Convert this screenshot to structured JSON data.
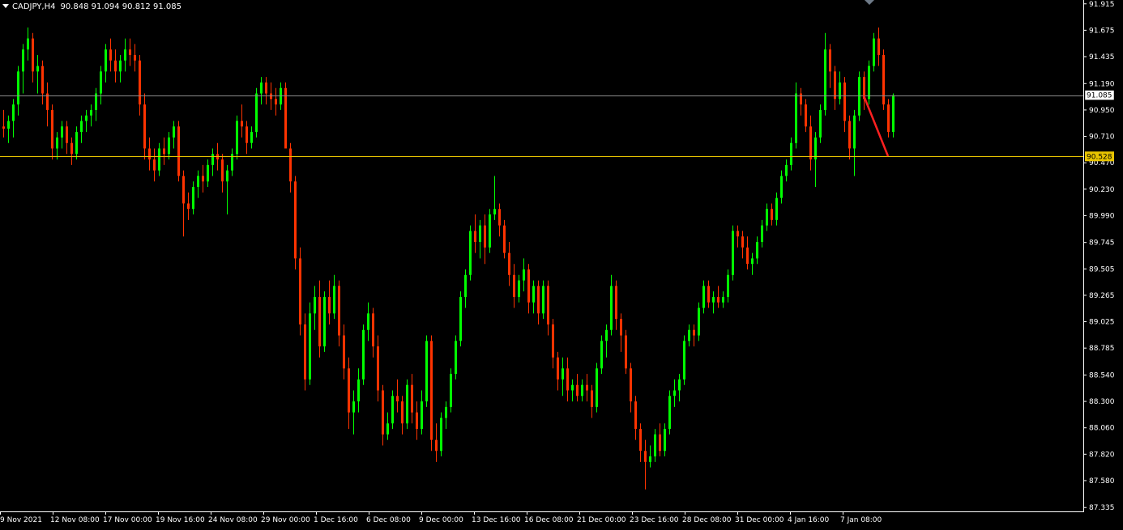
{
  "header": {
    "symbol": "CADJPY,H4",
    "ohlc": "90.848 91.094 90.812 91.085"
  },
  "colors": {
    "background": "#000000",
    "bull": "#00ff00",
    "bear": "#ff3300",
    "axis": "#ffffff",
    "bid_line": "#8c8c8c",
    "level_line": "#e8c400",
    "trend_line": "#ff2020"
  },
  "price_axis": {
    "labels": [
      "91.915",
      "91.675",
      "91.435",
      "91.190",
      "90.950",
      "90.710",
      "90.470",
      "90.230",
      "89.990",
      "89.745",
      "89.505",
      "89.265",
      "89.025",
      "88.785",
      "88.540",
      "88.300",
      "88.060",
      "87.820",
      "87.580",
      "87.335"
    ],
    "current_price": "91.085",
    "level_price": "90.528"
  },
  "time_axis": {
    "labels": [
      "9 Nov 2021",
      "12 Nov 08:00",
      "17 Nov 00:00",
      "19 Nov 16:00",
      "24 Nov 08:00",
      "29 Nov 00:00",
      "1 Dec 16:00",
      "6 Dec 08:00",
      "9 Dec 00:00",
      "13 Dec 16:00",
      "16 Dec 08:00",
      "21 Dec 00:00",
      "23 Dec 16:00",
      "28 Dec 08:00",
      "31 Dec 00:00",
      "4 Jan 16:00",
      "7 Jan 08:00"
    ]
  },
  "chart_data": {
    "type": "candlestick",
    "symbol": "CADJPY",
    "timeframe": "H4",
    "ylim": [
      87.3,
      91.95
    ],
    "y_ticks": [
      91.915,
      91.675,
      91.435,
      91.19,
      90.95,
      90.71,
      90.47,
      90.23,
      89.99,
      89.745,
      89.505,
      89.265,
      89.025,
      88.785,
      88.54,
      88.3,
      88.06,
      87.82,
      87.58,
      87.335
    ],
    "horizontal_lines": [
      {
        "price": 91.085,
        "label": "91.085",
        "role": "bid"
      },
      {
        "price": 90.528,
        "label": "90.528",
        "role": "level"
      }
    ],
    "trend_line": {
      "from_bar": 177,
      "from_price": 91.08,
      "to_bar": 182,
      "to_price": 90.53
    },
    "ohlc": [
      [
        90.8,
        90.95,
        90.7,
        90.78
      ],
      [
        90.78,
        90.9,
        90.65,
        90.85
      ],
      [
        90.85,
        91.05,
        90.7,
        91.0
      ],
      [
        91.0,
        91.35,
        90.9,
        91.3
      ],
      [
        91.3,
        91.55,
        91.1,
        91.5
      ],
      [
        91.5,
        91.7,
        91.4,
        91.6
      ],
      [
        91.6,
        91.65,
        91.2,
        91.3
      ],
      [
        91.3,
        91.45,
        91.1,
        91.35
      ],
      [
        91.35,
        91.4,
        91.0,
        91.1
      ],
      [
        91.1,
        91.2,
        90.8,
        90.95
      ],
      [
        90.95,
        91.0,
        90.5,
        90.6
      ],
      [
        90.6,
        90.75,
        90.5,
        90.7
      ],
      [
        90.7,
        90.85,
        90.6,
        90.8
      ],
      [
        90.8,
        90.85,
        90.55,
        90.65
      ],
      [
        90.65,
        90.7,
        90.45,
        90.55
      ],
      [
        90.55,
        90.8,
        90.5,
        90.75
      ],
      [
        90.75,
        90.9,
        90.65,
        90.85
      ],
      [
        90.85,
        90.95,
        90.75,
        90.9
      ],
      [
        90.9,
        91.0,
        90.8,
        90.95
      ],
      [
        90.95,
        91.15,
        90.85,
        91.1
      ],
      [
        91.1,
        91.35,
        91.0,
        91.3
      ],
      [
        91.3,
        91.55,
        91.2,
        91.5
      ],
      [
        91.5,
        91.6,
        91.3,
        91.4
      ],
      [
        91.4,
        91.5,
        91.2,
        91.3
      ],
      [
        91.3,
        91.45,
        91.2,
        91.4
      ],
      [
        91.4,
        91.6,
        91.3,
        91.5
      ],
      [
        91.5,
        91.6,
        91.35,
        91.45
      ],
      [
        91.45,
        91.55,
        91.3,
        91.4
      ],
      [
        91.4,
        91.45,
        90.9,
        91.0
      ],
      [
        91.0,
        91.1,
        90.5,
        90.6
      ],
      [
        90.6,
        90.7,
        90.4,
        90.5
      ],
      [
        90.5,
        90.6,
        90.3,
        90.4
      ],
      [
        90.4,
        90.65,
        90.35,
        90.6
      ],
      [
        90.6,
        90.7,
        90.45,
        90.55
      ],
      [
        90.55,
        90.75,
        90.5,
        90.7
      ],
      [
        90.7,
        90.85,
        90.6,
        90.8
      ],
      [
        90.8,
        90.85,
        90.3,
        90.35
      ],
      [
        90.35,
        90.4,
        89.8,
        90.1
      ],
      [
        90.1,
        90.2,
        89.95,
        90.05
      ],
      [
        90.05,
        90.3,
        90.0,
        90.25
      ],
      [
        90.25,
        90.4,
        90.15,
        90.35
      ],
      [
        90.35,
        90.45,
        90.2,
        90.3
      ],
      [
        90.3,
        90.5,
        90.25,
        90.45
      ],
      [
        90.45,
        90.6,
        90.35,
        90.55
      ],
      [
        90.55,
        90.65,
        90.4,
        90.5
      ],
      [
        90.5,
        90.55,
        90.2,
        90.3
      ],
      [
        90.3,
        90.45,
        90.0,
        90.4
      ],
      [
        90.4,
        90.6,
        90.35,
        90.55
      ],
      [
        90.55,
        90.9,
        90.5,
        90.85
      ],
      [
        90.85,
        91.0,
        90.7,
        90.8
      ],
      [
        90.8,
        90.85,
        90.55,
        90.65
      ],
      [
        90.65,
        90.8,
        90.6,
        90.75
      ],
      [
        90.75,
        91.15,
        90.7,
        91.1
      ],
      [
        91.1,
        91.25,
        91.0,
        91.2
      ],
      [
        91.2,
        91.25,
        91.0,
        91.1
      ],
      [
        91.1,
        91.2,
        90.95,
        91.05
      ],
      [
        91.05,
        91.15,
        90.9,
        91.0
      ],
      [
        91.0,
        91.2,
        90.95,
        91.15
      ],
      [
        91.15,
        91.2,
        90.9,
        90.6
      ],
      [
        90.6,
        90.65,
        90.2,
        90.3
      ],
      [
        90.3,
        90.35,
        89.5,
        89.6
      ],
      [
        89.6,
        89.7,
        88.9,
        89.0
      ],
      [
        89.0,
        89.1,
        88.4,
        88.5
      ],
      [
        88.5,
        89.2,
        88.45,
        89.1
      ],
      [
        89.1,
        89.35,
        88.95,
        89.25
      ],
      [
        89.25,
        89.4,
        88.7,
        88.8
      ],
      [
        88.8,
        89.3,
        88.75,
        89.25
      ],
      [
        89.25,
        89.4,
        89.0,
        89.1
      ],
      [
        89.1,
        89.45,
        89.05,
        89.35
      ],
      [
        89.35,
        89.4,
        88.8,
        88.9
      ],
      [
        88.9,
        89.0,
        88.5,
        88.6
      ],
      [
        88.6,
        88.7,
        88.05,
        88.2
      ],
      [
        88.2,
        88.4,
        88.0,
        88.3
      ],
      [
        88.3,
        88.6,
        88.2,
        88.5
      ],
      [
        88.5,
        89.0,
        88.45,
        88.95
      ],
      [
        88.95,
        89.2,
        88.85,
        89.1
      ],
      [
        89.1,
        89.15,
        88.7,
        88.8
      ],
      [
        88.8,
        88.9,
        88.3,
        88.4
      ],
      [
        88.4,
        88.45,
        87.9,
        88.0
      ],
      [
        88.0,
        88.2,
        87.95,
        88.1
      ],
      [
        88.1,
        88.4,
        88.05,
        88.35
      ],
      [
        88.35,
        88.5,
        88.2,
        88.3
      ],
      [
        88.3,
        88.35,
        88.0,
        88.1
      ],
      [
        88.1,
        88.5,
        88.05,
        88.45
      ],
      [
        88.45,
        88.55,
        88.1,
        88.2
      ],
      [
        88.2,
        88.3,
        87.95,
        88.05
      ],
      [
        88.05,
        88.4,
        88.0,
        88.3
      ],
      [
        88.3,
        88.9,
        88.25,
        88.85
      ],
      [
        88.85,
        88.9,
        87.85,
        87.95
      ],
      [
        87.95,
        88.1,
        87.75,
        87.85
      ],
      [
        87.85,
        88.2,
        87.8,
        88.15
      ],
      [
        88.15,
        88.3,
        88.05,
        88.25
      ],
      [
        88.25,
        88.6,
        88.2,
        88.55
      ],
      [
        88.55,
        88.9,
        88.5,
        88.85
      ],
      [
        88.85,
        89.3,
        88.8,
        89.25
      ],
      [
        89.25,
        89.5,
        89.15,
        89.45
      ],
      [
        89.45,
        89.9,
        89.4,
        89.85
      ],
      [
        89.85,
        90.0,
        89.65,
        89.75
      ],
      [
        89.75,
        89.95,
        89.6,
        89.9
      ],
      [
        89.9,
        90.0,
        89.55,
        89.7
      ],
      [
        89.7,
        90.05,
        89.65,
        90.0
      ],
      [
        90.0,
        90.35,
        89.95,
        90.05
      ],
      [
        90.05,
        90.1,
        89.8,
        89.9
      ],
      [
        89.9,
        89.95,
        89.6,
        89.65
      ],
      [
        89.65,
        89.75,
        89.35,
        89.45
      ],
      [
        89.45,
        89.55,
        89.15,
        89.25
      ],
      [
        89.25,
        89.45,
        89.2,
        89.4
      ],
      [
        89.4,
        89.6,
        89.3,
        89.5
      ],
      [
        89.5,
        89.55,
        89.1,
        89.2
      ],
      [
        89.2,
        89.4,
        89.1,
        89.35
      ],
      [
        89.35,
        89.4,
        89.0,
        89.1
      ],
      [
        89.1,
        89.4,
        89.05,
        89.35
      ],
      [
        89.35,
        89.4,
        88.9,
        89.0
      ],
      [
        89.0,
        89.05,
        88.6,
        88.7
      ],
      [
        88.7,
        88.75,
        88.4,
        88.5
      ],
      [
        88.5,
        88.7,
        88.35,
        88.6
      ],
      [
        88.6,
        88.7,
        88.3,
        88.4
      ],
      [
        88.4,
        88.5,
        88.3,
        88.45
      ],
      [
        88.45,
        88.55,
        88.3,
        88.35
      ],
      [
        88.35,
        88.5,
        88.3,
        88.45
      ],
      [
        88.45,
        88.55,
        88.3,
        88.4
      ],
      [
        88.4,
        88.45,
        88.15,
        88.25
      ],
      [
        88.25,
        88.65,
        88.2,
        88.6
      ],
      [
        88.6,
        88.9,
        88.55,
        88.85
      ],
      [
        88.85,
        89.0,
        88.7,
        88.95
      ],
      [
        88.95,
        89.45,
        88.9,
        89.35
      ],
      [
        89.35,
        89.4,
        88.95,
        89.05
      ],
      [
        89.05,
        89.1,
        88.75,
        88.9
      ],
      [
        88.9,
        88.95,
        88.55,
        88.6
      ],
      [
        88.6,
        88.65,
        88.2,
        88.3
      ],
      [
        88.3,
        88.35,
        87.95,
        88.05
      ],
      [
        88.05,
        88.1,
        87.75,
        87.85
      ],
      [
        87.85,
        87.95,
        87.5,
        87.75
      ],
      [
        87.75,
        87.9,
        87.7,
        87.8
      ],
      [
        87.8,
        88.05,
        87.75,
        88.0
      ],
      [
        88.0,
        88.1,
        87.8,
        87.85
      ],
      [
        87.85,
        88.1,
        87.8,
        88.05
      ],
      [
        88.05,
        88.4,
        88.0,
        88.35
      ],
      [
        88.35,
        88.5,
        88.25,
        88.4
      ],
      [
        88.4,
        88.55,
        88.3,
        88.5
      ],
      [
        88.5,
        88.9,
        88.45,
        88.85
      ],
      [
        88.85,
        89.0,
        88.8,
        88.95
      ],
      [
        88.95,
        89.0,
        88.8,
        88.9
      ],
      [
        88.9,
        89.2,
        88.85,
        89.15
      ],
      [
        89.15,
        89.4,
        89.1,
        89.35
      ],
      [
        89.35,
        89.4,
        89.15,
        89.2
      ],
      [
        89.2,
        89.3,
        89.1,
        89.25
      ],
      [
        89.25,
        89.35,
        89.15,
        89.2
      ],
      [
        89.2,
        89.3,
        89.15,
        89.25
      ],
      [
        89.25,
        89.5,
        89.2,
        89.45
      ],
      [
        89.45,
        89.9,
        89.4,
        89.85
      ],
      [
        89.85,
        89.9,
        89.7,
        89.8
      ],
      [
        89.8,
        89.85,
        89.6,
        89.7
      ],
      [
        89.7,
        89.8,
        89.5,
        89.55
      ],
      [
        89.55,
        89.65,
        89.45,
        89.6
      ],
      [
        89.6,
        89.8,
        89.55,
        89.75
      ],
      [
        89.75,
        89.95,
        89.7,
        89.9
      ],
      [
        89.9,
        90.1,
        89.85,
        90.05
      ],
      [
        90.05,
        90.1,
        89.9,
        89.95
      ],
      [
        89.95,
        90.2,
        89.9,
        90.15
      ],
      [
        90.15,
        90.4,
        90.1,
        90.35
      ],
      [
        90.35,
        90.5,
        90.3,
        90.45
      ],
      [
        90.45,
        90.7,
        90.4,
        90.65
      ],
      [
        90.65,
        91.2,
        90.6,
        91.1
      ],
      [
        91.1,
        91.15,
        90.9,
        91.0
      ],
      [
        91.0,
        91.05,
        90.75,
        90.8
      ],
      [
        90.8,
        90.9,
        90.4,
        90.5
      ],
      [
        90.5,
        90.75,
        90.25,
        90.7
      ],
      [
        90.7,
        91.0,
        90.65,
        90.95
      ],
      [
        90.95,
        91.65,
        90.9,
        91.5
      ],
      [
        91.5,
        91.55,
        91.15,
        91.3
      ],
      [
        91.3,
        91.35,
        90.95,
        91.05
      ],
      [
        91.05,
        91.3,
        91.0,
        91.2
      ],
      [
        91.2,
        91.25,
        90.75,
        90.85
      ],
      [
        90.85,
        90.9,
        90.5,
        90.6
      ],
      [
        90.6,
        90.95,
        90.35,
        90.9
      ],
      [
        90.9,
        91.3,
        90.85,
        91.25
      ],
      [
        91.25,
        91.3,
        90.95,
        91.05
      ],
      [
        91.05,
        91.4,
        91.0,
        91.35
      ],
      [
        91.35,
        91.65,
        91.3,
        91.6
      ],
      [
        91.6,
        91.7,
        91.35,
        91.45
      ],
      [
        91.45,
        91.5,
        90.95,
        91.0
      ],
      [
        91.0,
        91.05,
        90.7,
        90.75
      ],
      [
        90.75,
        91.1,
        90.7,
        91.085
      ]
    ]
  }
}
